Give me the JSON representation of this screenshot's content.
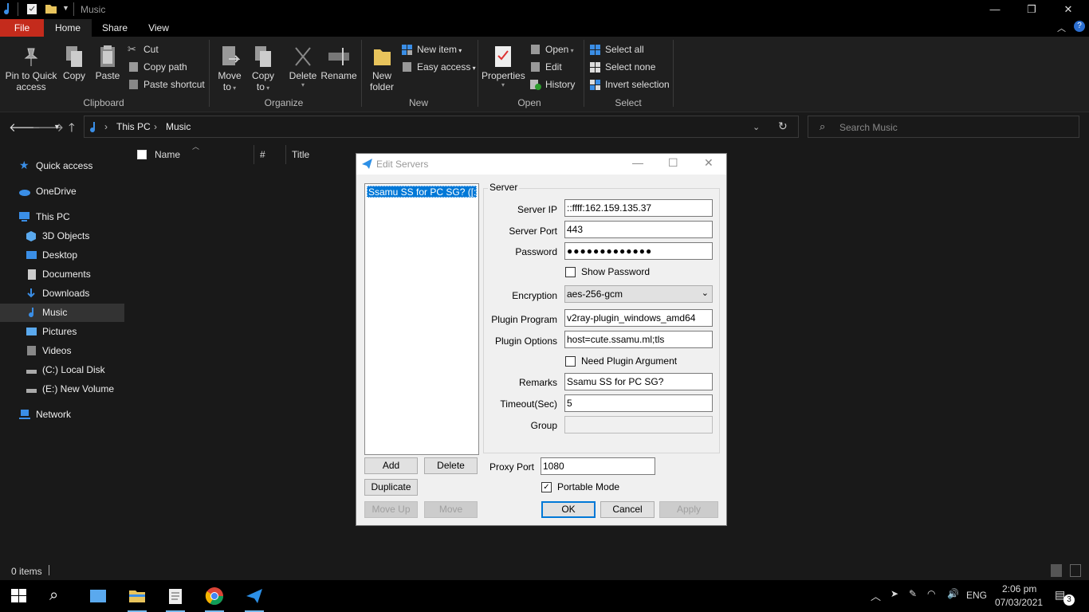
{
  "window": {
    "title": "Music"
  },
  "tabs": [
    "File",
    "Home",
    "Share",
    "View"
  ],
  "ribbon": {
    "clipboard": {
      "pin_label_1": "Pin to Quick",
      "pin_label_2": "access",
      "copy": "Copy",
      "paste": "Paste",
      "cut": "Cut",
      "copy_path": "Copy path",
      "paste_shortcut": "Paste shortcut",
      "group": "Clipboard"
    },
    "organize": {
      "move_1": "Move",
      "move_2": "to",
      "copy_1": "Copy",
      "copy_2": "to",
      "delete": "Delete",
      "rename": "Rename",
      "group": "Organize"
    },
    "new": {
      "folder_1": "New",
      "folder_2": "folder",
      "new_item": "New item",
      "easy_access": "Easy access",
      "group": "New"
    },
    "open": {
      "properties": "Properties",
      "open": "Open",
      "edit": "Edit",
      "history": "History",
      "group": "Open"
    },
    "select": {
      "all": "Select all",
      "none": "Select none",
      "invert": "Invert selection",
      "group": "Select"
    }
  },
  "address": {
    "seg1": "This PC",
    "seg2": "Music",
    "search_placeholder": "Search Music"
  },
  "nav": {
    "quick_access": "Quick access",
    "onedrive": "OneDrive",
    "this_pc": "This PC",
    "objects3d": "3D Objects",
    "desktop": "Desktop",
    "documents": "Documents",
    "downloads": "Downloads",
    "music": "Music",
    "pictures": "Pictures",
    "videos": "Videos",
    "local_disk": "(C:) Local Disk",
    "new_volume": "(E:) New Volume",
    "network": "Network"
  },
  "columns": {
    "name": "Name",
    "num": "#",
    "title": "Title"
  },
  "status": {
    "items": "0 items"
  },
  "taskbar": {
    "time": "2:06 pm",
    "date": "07/03/2021",
    "lang": "ENG",
    "notif_count": "3"
  },
  "dialog": {
    "title": "Edit Servers",
    "server_item": "Ssamu SS for PC SG? ([::fff",
    "group_label": "Server",
    "labels": {
      "server_ip": "Server IP",
      "server_port": "Server Port",
      "password": "Password",
      "show_password": "Show Password",
      "encryption": "Encryption",
      "plugin_program": "Plugin Program",
      "plugin_options": "Plugin Options",
      "need_plugin_arg": "Need Plugin Argument",
      "remarks": "Remarks",
      "timeout": "Timeout(Sec)",
      "group": "Group",
      "proxy_port": "Proxy Port",
      "portable_mode": "Portable Mode"
    },
    "values": {
      "server_ip": "::ffff:162.159.135.37",
      "server_port": "443",
      "password": "●●●●●●●●●●●●●",
      "encryption": "aes-256-gcm",
      "plugin_program": "v2ray-plugin_windows_amd64",
      "plugin_options": "host=cute.ssamu.ml;tls",
      "remarks": "Ssamu SS for PC SG?",
      "timeout": "5",
      "group": "",
      "proxy_port": "1080"
    },
    "buttons": {
      "add": "Add",
      "delete": "Delete",
      "duplicate": "Duplicate",
      "move_up": "Move Up",
      "move_down": "Move",
      "ok": "OK",
      "cancel": "Cancel",
      "apply": "Apply"
    }
  }
}
